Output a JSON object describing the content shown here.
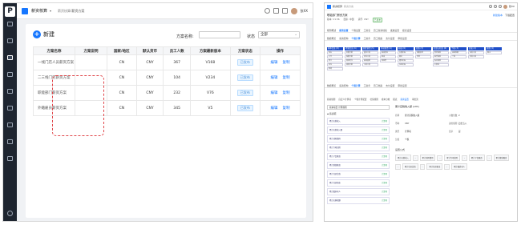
{
  "left": {
    "topbar": {
      "app_name": "薪资核算",
      "caret": "▾",
      "crumb_root": "薪资核算",
      "crumb_current": "薪资方案",
      "user": "张XX"
    },
    "toolbar": {
      "new_label": "新建",
      "search_label": "方案名称:",
      "status_label": "状态",
      "status_value": "全部"
    },
    "table": {
      "headers": [
        "方案名称",
        "方案说明",
        "国家/地区",
        "默认货币",
        "员工人数",
        "方案最新版本",
        "方案状态",
        "操作"
      ],
      "rows": [
        {
          "name": "一线门店人员薪资方案",
          "desc": "",
          "country": "CN",
          "currency": "CNY",
          "count": "367",
          "version": "V168",
          "status": "已发布"
        },
        {
          "name": "二三线门店薪资方案",
          "desc": "",
          "country": "CN",
          "currency": "CNY",
          "count": "104",
          "version": "V234",
          "status": "已发布"
        },
        {
          "name": "职能部门薪资方案",
          "desc": "",
          "country": "CN",
          "currency": "CNY",
          "count": "232",
          "version": "V76",
          "status": "已发布"
        },
        {
          "name": "外籍雇员薪资方案",
          "desc": "",
          "country": "CN",
          "currency": "CNY",
          "count": "345",
          "version": "V5",
          "status": "已发布"
        }
      ],
      "action_edit": "编辑",
      "action_copy": "复制"
    }
  },
  "right": {
    "topbar": {
      "app": "薪资核算",
      "crumb": "薪资方案",
      "user": "张XX"
    },
    "plan_name": "职能部门薪资方案",
    "meta": [
      "版本: V1.56",
      "国家: 中国",
      "货币: CNY"
    ],
    "status_tag": "已发布",
    "buttons": [
      "新建版本",
      "下载配置"
    ],
    "tabs1": [
      "规则概述",
      "薪资设置",
      "个税设置",
      "工资表",
      "员工薪资档案",
      "发放设置",
      "报表设置"
    ],
    "tabs2": [
      "数据概览",
      "薪资结构",
      "个税计算",
      "工资条",
      "员工档案",
      "支付设置",
      "审批设置"
    ],
    "flow_cols": [
      {
        "head": "基本信息 (8)",
        "items": [
          "姓名",
          "工号",
          "部门",
          "岗位",
          "职级"
        ]
      },
      {
        "head": "考勤信息 (6)",
        "items": [
          "出勤天数",
          "缺勤天数",
          "加班时长",
          "请假天数"
        ]
      },
      {
        "head": "固定薪资 (5)",
        "items": [
          "基本工资",
          "岗位工资",
          "绩效基数",
          "工龄工资"
        ]
      },
      {
        "head": "浮动薪资 (4)",
        "items": [
          "绩效奖金",
          "提成",
          "加班费"
        ]
      },
      {
        "head": "补贴 (6)",
        "items": [
          "交通补贴",
          "餐补",
          "通讯补贴",
          "住房补贴"
        ]
      },
      {
        "head": "扣款 (3)",
        "items": [
          "缺勤扣款",
          "罚款"
        ]
      },
      {
        "head": "社保公积金 (6)",
        "items": [
          "养老保险",
          "医疗保险",
          "失业保险",
          "公积金"
        ]
      },
      {
        "head": "个税 (3)",
        "items": [
          "应纳税额",
          "个税"
        ]
      },
      {
        "head": "实发 (2)",
        "items": [
          "应发工资",
          "实发工资"
        ]
      },
      {
        "head": "其他 (2)",
        "items": [
          "备注"
        ]
      }
    ],
    "tools": [
      "薪资规则",
      "自定义计算项",
      "个税计算配置",
      "社保规则",
      "成本分摊",
      "报表",
      "薪资设置",
      "审批流"
    ],
    "pane": {
      "select": "薪资项目 计算规则",
      "folder": "薪资项",
      "items": [
        {
          "name": "累计应税收入",
          "type": "计算项"
        },
        {
          "name": "累计应税收入额",
          "type": "计算项"
        },
        {
          "name": "累计减除费用",
          "type": "计算项"
        },
        {
          "name": "累计专项扣除",
          "type": "计算项"
        },
        {
          "name": "累计子女教育",
          "type": "计算项"
        },
        {
          "name": "累计继续教育",
          "type": "计算项"
        },
        {
          "name": "累计住房贷款",
          "type": "计算项"
        },
        {
          "name": "累计住房租金",
          "type": "计算项"
        },
        {
          "name": "累计赡养老人",
          "type": "计算项"
        },
        {
          "name": "累计应纳税额",
          "type": "计算项"
        }
      ]
    },
    "form": {
      "title": "累计应税收入额 (u01)",
      "rows": [
        {
          "k": "名称",
          "v": "累计应税收入额",
          "k2": "小数位数",
          "v2": "2"
        },
        {
          "k": "币种",
          "v": "CNY",
          "k2": "进位规则",
          "v2": "四舍五入"
        },
        {
          "k": "类型",
          "v": "计算项",
          "k2": "显示",
          "v2": "是"
        },
        {
          "k": "分组",
          "v": "个税",
          "k2": "",
          "v2": ""
        }
      ],
      "section": "设置公式",
      "chips": [
        "累计应税收入",
        "-",
        "累计减除费用",
        "-",
        "累计专项扣除",
        "-",
        "累计子女教育",
        "-",
        "累计继续教育",
        "-",
        "累计住房贷款",
        "-",
        "累计住房租金",
        "-",
        "累计赡养老人"
      ]
    }
  }
}
